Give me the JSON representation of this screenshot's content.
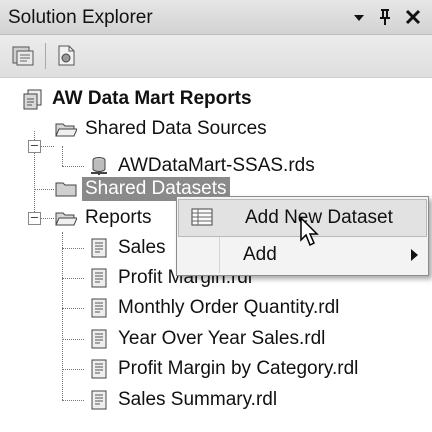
{
  "window": {
    "title": "Solution Explorer",
    "controls": {
      "dropdown_icon": "chevron-down-icon",
      "pin_icon": "pin-icon",
      "close_icon": "close-icon"
    }
  },
  "toolbar": {
    "buttons": [
      {
        "icon": "properties-icon"
      },
      {
        "icon": "show-all-files-icon"
      }
    ]
  },
  "tree": {
    "root": {
      "label": "AW Data Mart Reports",
      "icon": "project-icon"
    },
    "shared_data_sources": {
      "label": "Shared Data Sources",
      "expanded": true,
      "children": [
        {
          "label": "AWDataMart-SSAS.rds",
          "icon": "datasource-icon"
        }
      ]
    },
    "shared_datasets": {
      "label": "Shared Datasets",
      "selected": true
    },
    "reports": {
      "label": "Reports",
      "expanded": true,
      "children": [
        {
          "label": "Sales"
        },
        {
          "label": "Profit Margin.rdl"
        },
        {
          "label": "Monthly Order Quantity.rdl"
        },
        {
          "label": "Year Over Year Sales.rdl"
        },
        {
          "label": "Profit Margin by Category.rdl"
        },
        {
          "label": "Sales Summary.rdl"
        }
      ]
    }
  },
  "context_menu": {
    "items": [
      {
        "label": "Add New Dataset",
        "icon": "dataset-icon",
        "highlighted": true
      },
      {
        "label": "Add",
        "has_submenu": true
      }
    ]
  },
  "colors": {
    "titlebar": "#d8d8d8",
    "selection": "#8a8a8a",
    "menu_bg": "#f3f3f3",
    "menu_highlight": "#e2e2e2"
  }
}
